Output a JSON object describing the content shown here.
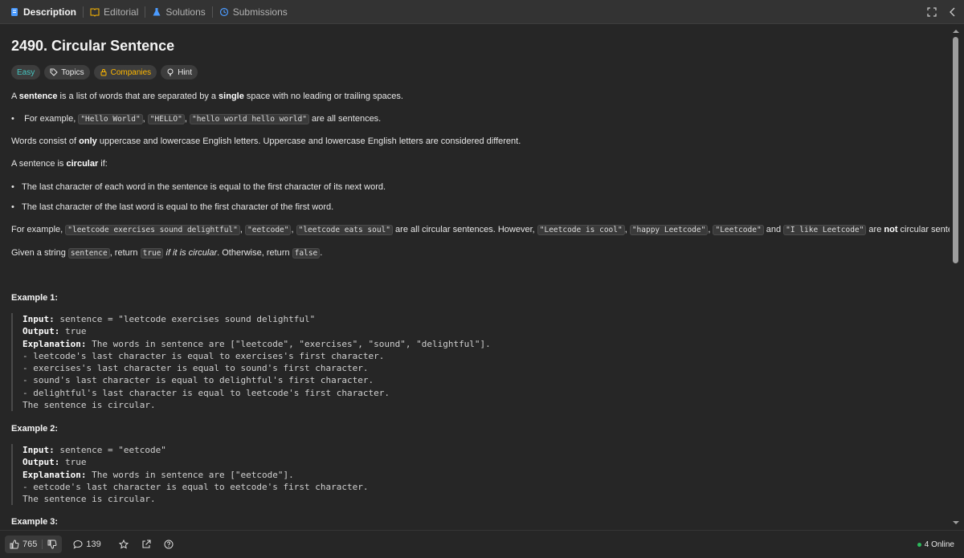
{
  "tabs": [
    {
      "label": "Description",
      "icon": "description-icon",
      "active": true
    },
    {
      "label": "Editorial",
      "icon": "book-icon"
    },
    {
      "label": "Solutions",
      "icon": "flask-icon"
    },
    {
      "label": "Submissions",
      "icon": "history-icon"
    }
  ],
  "problem": {
    "title": "2490. Circular Sentence",
    "tags": {
      "difficulty": "Easy",
      "topics": "Topics",
      "companies": "Companies",
      "hint": "Hint"
    }
  },
  "desc": {
    "p1": {
      "a": "A ",
      "b": "sentence",
      "c": " is a list of words that are separated by a ",
      "d": "single",
      "e": " space with no leading or trailing spaces."
    },
    "b1": {
      "a": "For example, ",
      "c1": "\"Hello World\"",
      "s1": ", ",
      "c2": "\"HELLO\"",
      "s2": ", ",
      "c3": "\"hello world hello world\"",
      "e": " are all sentences."
    },
    "p2": {
      "a": "Words consist of ",
      "b": "only",
      "c": " uppercase and lowercase English letters. Uppercase and lowercase English letters are considered different."
    },
    "p3": {
      "a": "A sentence is ",
      "b": "circular",
      "c": " if:"
    },
    "b2": "The last character of each word in the sentence is equal to the first character of its next word.",
    "b3": "The last character of the last word is equal to the first character of the first word.",
    "p4": {
      "a": "For example, ",
      "c1": "\"leetcode exercises sound delightful\"",
      "s1": ", ",
      "c2": "\"eetcode\"",
      "s2": ", ",
      "c3": "\"leetcode eats soul\"",
      "m": " are all circular sentences. However, ",
      "c4": "\"Leetcode is cool\"",
      "s3": ", ",
      "c5": "\"happy Leetcode\"",
      "s4": ", ",
      "c6": "\"Leetcode\"",
      "s5": " and ",
      "c7": "\"I like Leetcode\"",
      "s6": " are ",
      "b": "not",
      "e": " circular sentences."
    },
    "p5": {
      "a": "Given a string ",
      "c1": "sentence",
      "s1": ", return ",
      "c2": "true",
      "i": " if it is circular",
      "s2": ". Otherwise, return ",
      "c3": "false",
      "e": "."
    }
  },
  "examples": [
    {
      "title": "Example 1:",
      "input_label": "Input:",
      "input": " sentence = \"leetcode exercises sound delightful\"",
      "output_label": "Output:",
      "output": " true",
      "expl_label": "Explanation:",
      "expl": " The words in sentence are [\"leetcode\", \"exercises\", \"sound\", \"delightful\"].",
      "lines": [
        "- leetcode's last character is equal to exercises's first character.",
        "- exercises's last character is equal to sound's first character.",
        "- sound's last character is equal to delightful's first character.",
        "- delightful's last character is equal to leetcode's first character."
      ],
      "end": "The sentence is circular."
    },
    {
      "title": "Example 2:",
      "input_label": "Input:",
      "input": " sentence = \"eetcode\"",
      "output_label": "Output:",
      "output": " true",
      "expl_label": "Explanation:",
      "expl": " The words in sentence are [\"eetcode\"].",
      "lines": [
        "- eetcode's last character is equal to eetcode's first character."
      ],
      "end": "The sentence is circular."
    },
    {
      "title": "Example 3:"
    }
  ],
  "bottom": {
    "likes": "765",
    "comments": "139",
    "online": "4 Online"
  },
  "colors": {
    "easy": "#46c6c2",
    "companies": "#ffb800",
    "online_dot": "#2cbb5d"
  }
}
